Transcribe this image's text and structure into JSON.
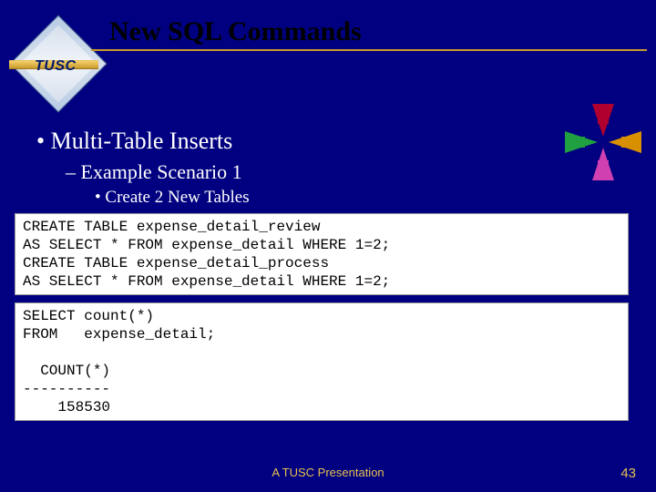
{
  "logo": {
    "brand": "TUSC"
  },
  "title": "New SQL Commands",
  "bullets": {
    "level1": "Multi-Table Inserts",
    "level2": "Example Scenario 1",
    "level3": "Create 2 New Tables"
  },
  "code_block_1": "CREATE TABLE expense_detail_review\nAS SELECT * FROM expense_detail WHERE 1=2;\nCREATE TABLE expense_detail_process\nAS SELECT * FROM expense_detail WHERE 1=2;",
  "code_block_2": "SELECT count(*)\nFROM   expense_detail;\n\n  COUNT(*)\n----------\n    158530",
  "footer": "A TUSC Presentation",
  "page_number": "43"
}
